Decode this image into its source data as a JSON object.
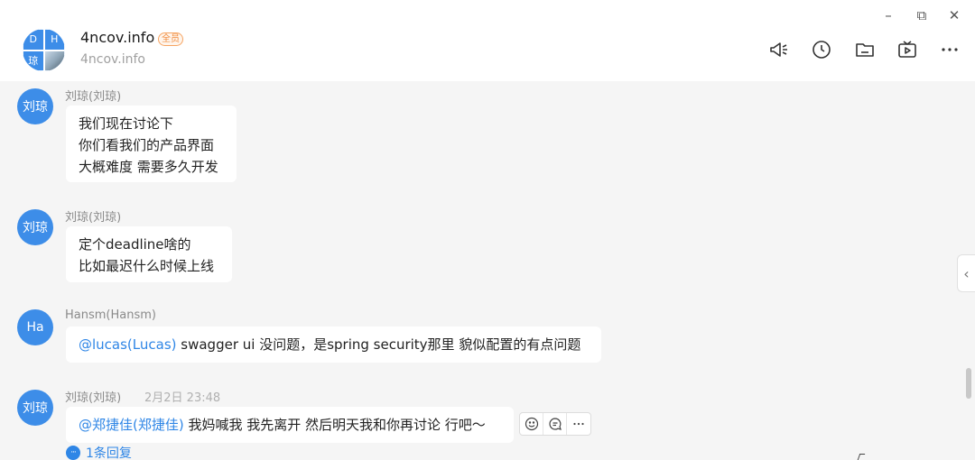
{
  "header": {
    "avatar_cells": [
      "D",
      "H",
      "琼"
    ],
    "group_name": "4ncov.info",
    "member_badge": "全员",
    "group_domain": "4ncov.info"
  },
  "window_controls": {
    "minimize": "–",
    "restore": "⧉",
    "close": "✕"
  },
  "toolbar_icons": [
    "announcement-icon",
    "history-clock-icon",
    "folder-icon",
    "live-video-icon",
    "more-icon"
  ],
  "messages": [
    {
      "avatar": "刘琼",
      "sender": "刘琼(刘琼)",
      "lines": [
        "我们现在讨论下",
        "你们看我们的产品界面",
        "大概难度 需要多久开发"
      ]
    },
    {
      "avatar": "刘琼",
      "sender": "刘琼(刘琼)",
      "lines": [
        "定个deadline啥的",
        "比如最迟什么时候上线"
      ]
    },
    {
      "avatar": "Ha",
      "sender": "Hansm(Hansm)",
      "mention": "@lucas(Lucas)",
      "text": " swagger ui 没问题，是spring security那里 貌似配置的有点问题"
    },
    {
      "avatar": "刘琼",
      "sender": "刘琼(刘琼)",
      "timestamp": "2月2日 23:48",
      "mention": "@郑捷佳(郑捷佳)",
      "text": " 我妈喊我 我先离开 然后明天我和你再讨论 行吧～",
      "reply_count_label": "1条回复",
      "reply_dot": "···"
    }
  ],
  "side_toggle": "‹",
  "colors": {
    "accent": "#2f86e6",
    "avatar_bg": "#3d8de8",
    "chat_bg": "#f5f5f5",
    "badge": "#f08a3c"
  }
}
